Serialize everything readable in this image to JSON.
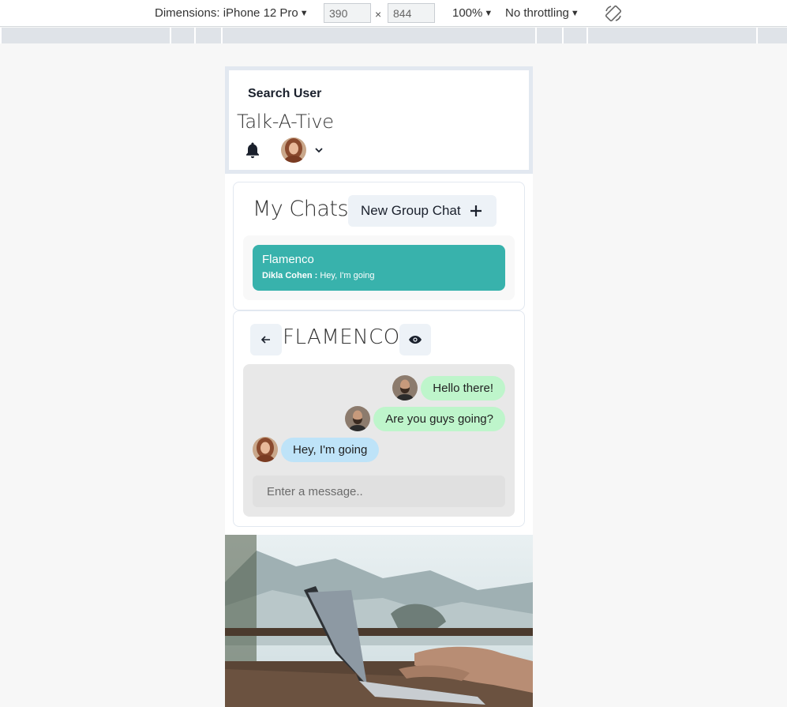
{
  "devtools": {
    "dimensions_label": "Dimensions: iPhone 12 Pro",
    "width": "390",
    "height": "844",
    "times": "×",
    "zoom": "100%",
    "throttling": "No throttling"
  },
  "header": {
    "search_label": "Search User",
    "brand": "Talk-A-Tive"
  },
  "my_chats": {
    "title": "My Chats",
    "new_group_label": "New Group Chat",
    "chats": [
      {
        "name": "Flamenco",
        "sender": "Dikla Cohen :",
        "message": "Hey, I'm going"
      }
    ]
  },
  "chat_box": {
    "title": "FLAMENCO",
    "messages": [
      {
        "text": "Hello there!",
        "type": "sent"
      },
      {
        "text": "Are you guys going?",
        "type": "sent"
      },
      {
        "text": "Hey, I'm going",
        "type": "received"
      }
    ],
    "input_placeholder": "Enter a message.."
  },
  "colors": {
    "accent": "#38b2ac",
    "sent_bubble": "#bef5cb",
    "received_bubble": "#bee3f8",
    "button_bg": "#edf2f7"
  },
  "icons": [
    "search-icon",
    "bell-icon",
    "chevron-down-icon",
    "plus-icon",
    "arrow-left-icon",
    "eye-icon",
    "rotate-icon"
  ]
}
